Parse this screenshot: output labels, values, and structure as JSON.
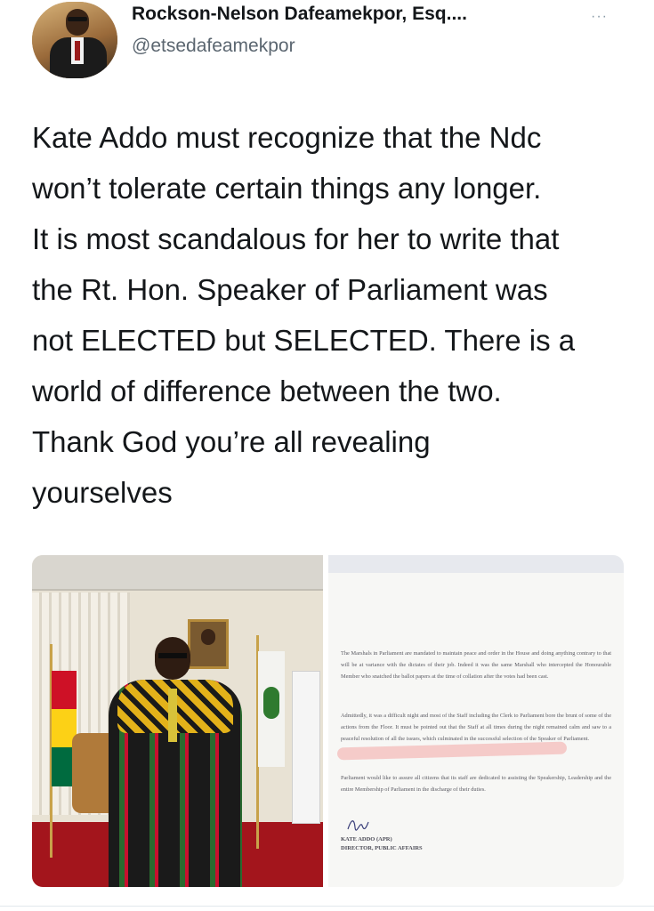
{
  "author": {
    "name": "Rockson-Nelson Dafeamekpor, Esq....",
    "handle": "@etsedafeamekpor",
    "more_menu": "···"
  },
  "tweet": {
    "text": "Kate Addo must recognize that the Ndc\nwon’t tolerate certain things any longer.\nIt is most scandalous for her to write that\nthe Rt. Hon. Speaker of Parliament was\nnot ELECTED but SELECTED. There is a\nworld of difference between the two.\nThank God you’re all revealing\nyourselves"
  },
  "document": {
    "paragraph1": "The Marshals in Parliament are mandated to maintain peace and order in the House and doing anything contrary to that will be at variance with the dictates of their job. Indeed it was the same Marshall who intercepted the Honourable Member who snatched the ballot papers at the time of collation after the votes had been cast.",
    "paragraph2": "Admittedly, it was a difficult night and most of the Staff including the Clerk to Parliament bore the brunt of some of the actions from the Floor. It must be pointed out that the Staff at all times during the night remained calm and saw to a peaceful resolution of all the issues, which culminated in the successful selection of the Speaker of Parliament.",
    "paragraph3": "Parliament would like to assure all citizens that its staff are dedicated to assisting the Speakership, Leadership and the entire Membership of Parliament in the discharge of their duties.",
    "signatory_name": "KATE ADDO (APR)",
    "signatory_title": "DIRECTOR, PUBLIC AFFAIRS"
  }
}
